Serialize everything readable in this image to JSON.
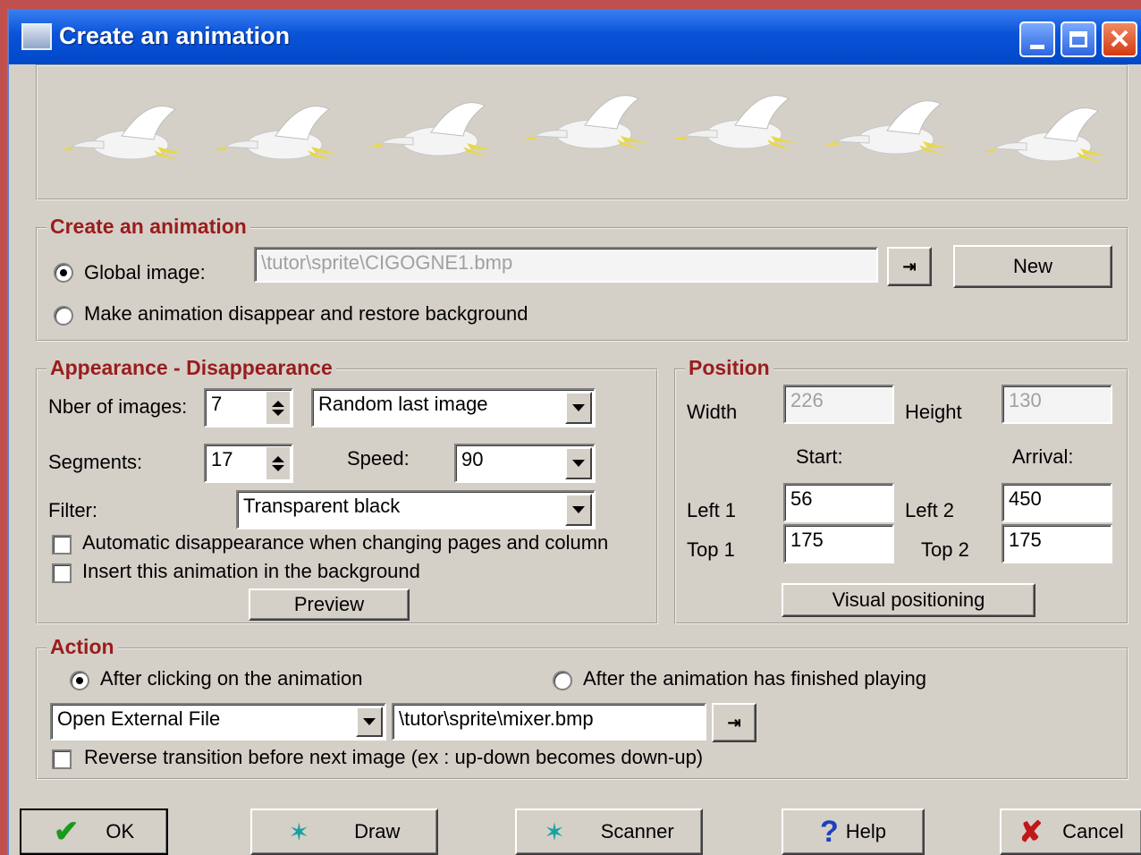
{
  "window": {
    "title": "Create an animation"
  },
  "create_section": {
    "legend": "Create an animation",
    "global_image_label": "Global image:",
    "global_image_value": "\\tutor\\sprite\\CIGOGNE1.bmp",
    "disappear_label": "Make animation disappear and restore background",
    "new_button": "New",
    "global_image_selected": true
  },
  "appearance_section": {
    "legend": "Appearance - Disappearance",
    "nber_label": "Nber of images:",
    "nber_value": "7",
    "mode_value": "Random last image",
    "segments_label": "Segments:",
    "segments_value": "17",
    "speed_label": "Speed:",
    "speed_value": "90",
    "filter_label": "Filter:",
    "filter_value": "Transparent black",
    "auto_disappear_label": "Automatic disappearance when changing pages and column",
    "insert_background_label": "Insert this animation in the background",
    "preview_button": "Preview"
  },
  "position_section": {
    "legend": "Position",
    "width_label": "Width",
    "width_value": "226",
    "height_label": "Height",
    "height_value": "130",
    "start_label": "Start:",
    "arrival_label": "Arrival:",
    "left1_label": "Left 1",
    "left1_value": "56",
    "top1_label": "Top 1",
    "top1_value": "175",
    "left2_label": "Left 2",
    "left2_value": "450",
    "top2_label": "Top 2",
    "top2_value": "175",
    "visual_button": "Visual positioning"
  },
  "action_section": {
    "legend": "Action",
    "after_click_label": "After clicking on the animation",
    "after_finished_label": "After the animation has finished playing",
    "action_value": "Open External File",
    "file_value": "\\tutor\\sprite\\mixer.bmp",
    "reverse_label": "Reverse transition before next image (ex : up-down becomes down-up)",
    "after_click_selected": true
  },
  "buttons": {
    "ok": "OK",
    "draw": "Draw",
    "scanner": "Scanner",
    "help": "Help",
    "cancel": "Cancel"
  },
  "icons": [
    "app-icon",
    "minimize-icon",
    "maximize-icon",
    "close-icon",
    "browse-arrow-icon",
    "check-icon",
    "figure-icon",
    "help-icon",
    "cancel-x-icon",
    "stork-sprite"
  ],
  "colors": {
    "legend": "#9b1c1c",
    "titlebar": "#0a53d8",
    "background": "#d4d0c8"
  }
}
